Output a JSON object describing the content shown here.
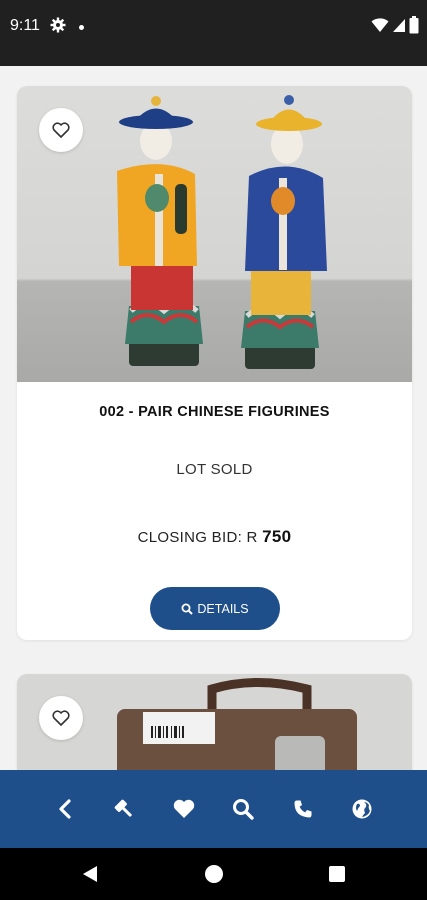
{
  "status_bar": {
    "time": "9:11"
  },
  "lots": [
    {
      "title": "002 - PAIR CHINESE FIGURINES",
      "status": "LOT SOLD",
      "closing_bid_label": "CLOSING BID: R",
      "closing_bid_amount": "750",
      "details_label": "DETAILS"
    }
  ],
  "bottom_nav": {
    "items": [
      "back-icon",
      "gavel-icon",
      "heart-icon",
      "search-icon",
      "phone-icon",
      "globe-icon"
    ]
  },
  "colors": {
    "accent": "#1f4f8a",
    "status_bar": "#202020"
  }
}
